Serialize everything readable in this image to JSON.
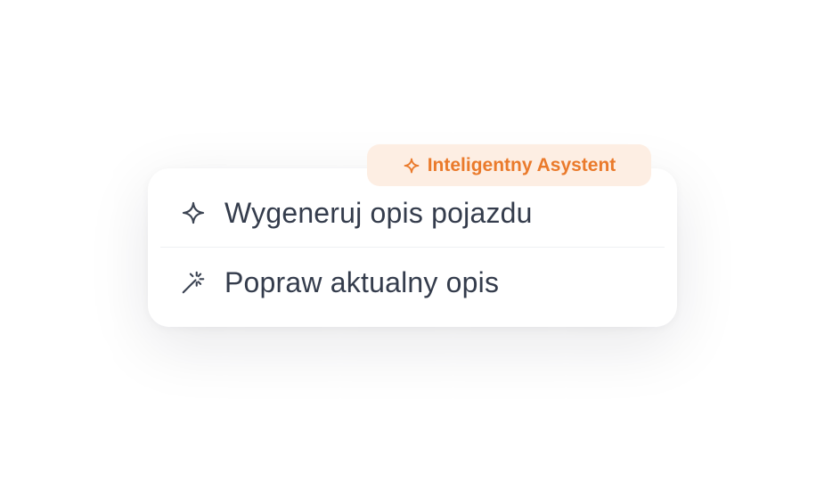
{
  "badge": {
    "label": "Inteligentny Asystent",
    "icon": "sparkle-icon",
    "color": "#ea7a2b",
    "background": "#fdeee3"
  },
  "menu": {
    "items": [
      {
        "label": "Wygeneruj opis pojazdu",
        "icon": "sparkle-icon"
      },
      {
        "label": "Popraw aktualny opis",
        "icon": "magic-wand-icon"
      }
    ]
  },
  "colors": {
    "text": "#343c4c",
    "divider": "#eef0f3"
  }
}
